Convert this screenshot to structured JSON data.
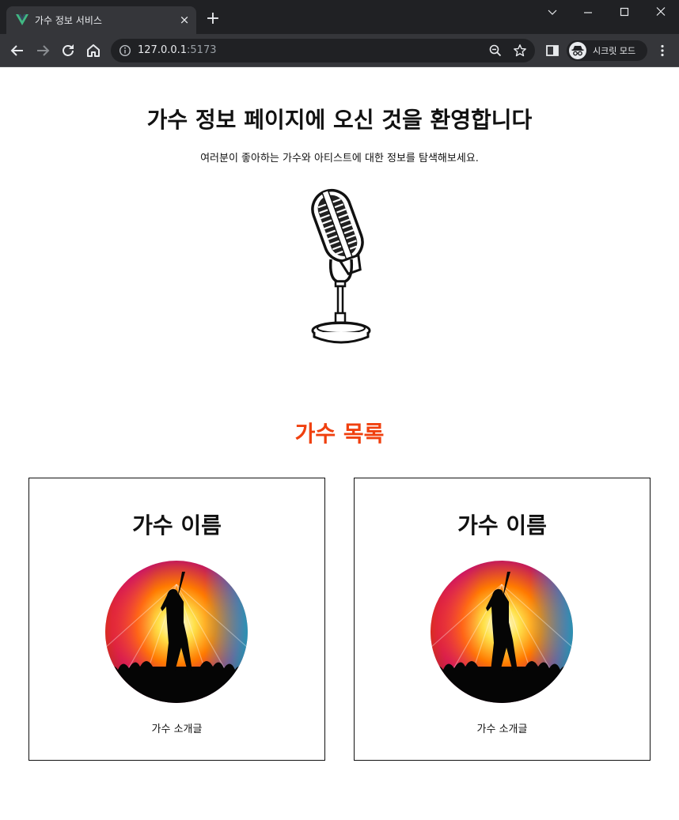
{
  "browser": {
    "tab_title": "가수 정보 서비스",
    "tab_close": "×",
    "new_tab": "+",
    "url_host": "127.0.0.1",
    "url_port": ":5173",
    "profile_label": "시크릿 모드",
    "icons": [
      "vue-logo-icon",
      "close-icon",
      "plus-icon",
      "chevron-down-icon",
      "minimize-icon",
      "maximize-icon",
      "window-close-icon",
      "back-arrow-icon",
      "forward-arrow-icon",
      "reload-icon",
      "home-icon",
      "info-icon",
      "zoom-icon",
      "star-icon",
      "side-panel-icon",
      "incognito-icon",
      "menu-dots-icon"
    ]
  },
  "hero": {
    "title": "가수 정보 페이지에 오신 것을 환영합니다",
    "subtitle": "여러분이 좋아하는 가수와 아티스트에 대한 정보를 탐색해보세요."
  },
  "singers_section": {
    "title": "가수 목록",
    "title_color": "#f0400f",
    "cards": [
      {
        "name": "가수 이름",
        "description": "가수 소개글"
      },
      {
        "name": "가수 이름",
        "description": "가수 소개글"
      }
    ]
  }
}
